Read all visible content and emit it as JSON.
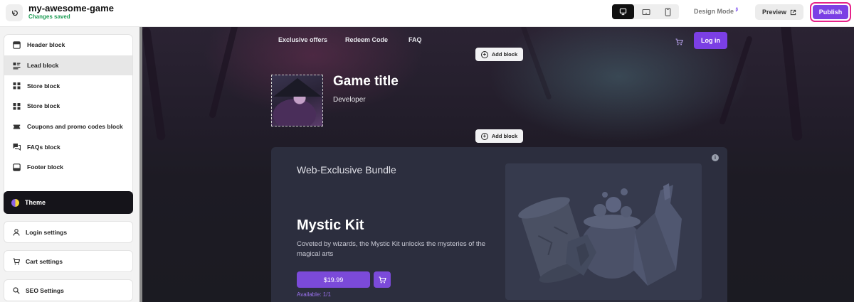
{
  "topbar": {
    "project_name": "my-awesome-game",
    "save_status": "Changes saved",
    "design_mode_label": "Design Mode",
    "design_mode_badge": "β",
    "preview_label": "Preview",
    "publish_label": "Publish",
    "devices": [
      "desktop-icon",
      "tablet-landscape-icon",
      "mobile-icon"
    ],
    "active_device": "desktop"
  },
  "sidebar": {
    "blocks": [
      {
        "label": "Header block",
        "icon": "header-block-icon"
      },
      {
        "label": "Lead block",
        "icon": "lead-block-icon",
        "active": true
      },
      {
        "label": "Store block",
        "icon": "store-block-icon"
      },
      {
        "label": "Store block",
        "icon": "store-block-icon"
      },
      {
        "label": "Coupons and promo codes block",
        "icon": "coupon-icon"
      },
      {
        "label": "FAQs block",
        "icon": "faq-icon"
      },
      {
        "label": "Footer block",
        "icon": "footer-block-icon"
      }
    ],
    "theme_label": "Theme",
    "login_settings_label": "Login settings",
    "cart_settings_label": "Cart settings",
    "seo_settings_label": "SEO Settings"
  },
  "canvas": {
    "nav": {
      "links": [
        "Exclusive offers",
        "Redeem Code",
        "FAQ"
      ],
      "login_label": "Log in"
    },
    "add_block_label": "Add block",
    "hero": {
      "title": "Game title",
      "developer": "Developer"
    },
    "card": {
      "bundle_label": "Web-Exclusive Bundle",
      "product_name": "Mystic Kit",
      "description": "Coveted by wizards, the Mystic Kit unlocks the mysteries of the magical arts",
      "price": "$19.99",
      "availability": "Available: 1/1",
      "info_icon": "i"
    }
  },
  "colors": {
    "accent": "#7b3fe4",
    "publish_highlight": "#e6238a",
    "saved_green": "#1f9d55"
  }
}
